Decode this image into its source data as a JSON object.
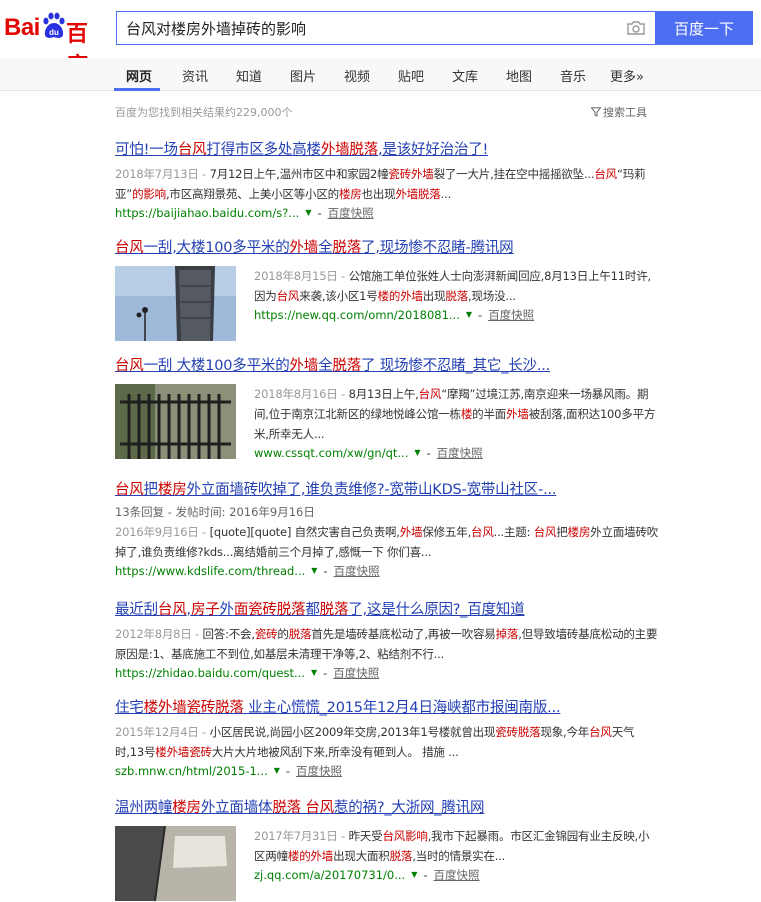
{
  "logo": {
    "left_text": "Bai",
    "right_text": "百度",
    "paw_text": "du"
  },
  "search": {
    "query": "台风对楼房外墙掉砖的影响",
    "button_label": "百度一下"
  },
  "tabs": [
    "网页",
    "资讯",
    "知道",
    "图片",
    "视频",
    "贴吧",
    "文库",
    "地图",
    "音乐",
    "更多»"
  ],
  "meta": {
    "result_count": "百度为您找到相关结果约229,000个",
    "search_tools": "搜索工具"
  },
  "snapshot_label": "百度快照",
  "results": [
    {
      "title": [
        [
          "可怕!一场",
          ""
        ],
        [
          "台风",
          "em"
        ],
        [
          "打得市区多处高楼",
          ""
        ],
        [
          "外墙脱落",
          "em"
        ],
        [
          ",是该好好治治了!",
          ""
        ]
      ],
      "abstract": [
        [
          "2018年7月13日 - ",
          "date"
        ],
        [
          "7月12日上午,温州市区中和家园2幢",
          ""
        ],
        [
          "瓷砖外墙",
          "em"
        ],
        [
          "裂了一大片,挂在空中摇摇欲坠...",
          ""
        ],
        [
          "台风",
          "em"
        ],
        [
          "“玛莉亚”",
          ""
        ],
        [
          "的影响",
          "em"
        ],
        [
          ",市区高翔景苑、上美小区等小区的",
          ""
        ],
        [
          "楼房",
          "em"
        ],
        [
          "也出现",
          ""
        ],
        [
          "外墙脱落",
          "em"
        ],
        [
          "...",
          ""
        ]
      ],
      "url": "https://baijiahao.baidu.com/s?..."
    },
    {
      "title": [
        [
          "台风",
          "em"
        ],
        [
          "一刮,大楼100多平米的",
          ""
        ],
        [
          "外墙",
          "em"
        ],
        [
          "全",
          ""
        ],
        [
          "脱落",
          "em"
        ],
        [
          "了,现场惨不忍睹-腾讯网",
          ""
        ]
      ],
      "abstract": [
        [
          "2018年8月15日 - ",
          "date"
        ],
        [
          "公馆施工单位张姓人士向澎湃新闻回应,8月13日上午11时许,因为",
          ""
        ],
        [
          "台风",
          "em"
        ],
        [
          "来袭,该小区1号",
          ""
        ],
        [
          "楼的外墙",
          "em"
        ],
        [
          "出现",
          ""
        ],
        [
          "脱落",
          "em"
        ],
        [
          ",现场没...",
          ""
        ]
      ],
      "url": "https://new.qq.com/omn/2018081..."
    },
    {
      "title": [
        [
          "台风",
          "em"
        ],
        [
          "一刮 大楼100多平米的",
          ""
        ],
        [
          "外墙",
          "em"
        ],
        [
          "全",
          ""
        ],
        [
          "脱落",
          "em"
        ],
        [
          "了 现场惨不忍睹_其它_长沙...",
          ""
        ]
      ],
      "abstract": [
        [
          "2018年8月16日 - ",
          "date"
        ],
        [
          "8月13日上午,",
          ""
        ],
        [
          "台风",
          "em"
        ],
        [
          "“摩羯”过境江苏,南京迎来一场暴风雨。期间,位于南京江北新区的绿地悦峰公馆一栋",
          ""
        ],
        [
          "楼",
          "em"
        ],
        [
          "的半面",
          ""
        ],
        [
          "外墙",
          "em"
        ],
        [
          "被刮落,面积达100多平方米,所幸无人...",
          ""
        ]
      ],
      "url": "www.cssqt.com/xw/gn/qt..."
    },
    {
      "title": [
        [
          "台风",
          "em"
        ],
        [
          "把",
          ""
        ],
        [
          "楼房",
          "em"
        ],
        [
          "外立面墙砖吹掉了,谁负责维修?-宽带山KDS-宽带山社区-...",
          ""
        ]
      ],
      "sub": "13条回复 - 发帖时间: 2016年9月16日",
      "abstract": [
        [
          "2016年9月16日 - ",
          "date"
        ],
        [
          "[quote][quote] 自然灾害自己负责啊,",
          ""
        ],
        [
          "外墙",
          "em"
        ],
        [
          "保修五年,",
          ""
        ],
        [
          "台风",
          "em"
        ],
        [
          "...主题: ",
          ""
        ],
        [
          "台风",
          "em"
        ],
        [
          "把",
          ""
        ],
        [
          "楼房",
          "em"
        ],
        [
          "外立面墙砖吹掉了,谁负责维修?kds...离结婚前三个月掉了,感慨一下 你们喜...",
          ""
        ]
      ],
      "url": "https://www.kdslife.com/thread..."
    },
    {
      "title": [
        [
          "最近刮",
          ""
        ],
        [
          "台风",
          "em"
        ],
        [
          ",",
          ""
        ],
        [
          "房子",
          "em"
        ],
        [
          "外",
          ""
        ],
        [
          "面瓷砖脱落",
          "em"
        ],
        [
          "都",
          ""
        ],
        [
          "脱落",
          "em"
        ],
        [
          "了,这是什么原因?_百度知道",
          ""
        ]
      ],
      "abstract": [
        [
          "2012年8月8日 - ",
          "date"
        ],
        [
          "回答:不会,",
          ""
        ],
        [
          "瓷砖",
          "em"
        ],
        [
          "的",
          ""
        ],
        [
          "脱落",
          "em"
        ],
        [
          "首先是墙砖基底松动了,再被一吹容易",
          ""
        ],
        [
          "掉落",
          "em"
        ],
        [
          ",但导致墙砖基底松动的主要原因是:1、基底施工不到位,如基层未清理干净等,2、粘结剂不行...",
          ""
        ]
      ],
      "url": "https://zhidao.baidu.com/quest..."
    },
    {
      "title": [
        [
          "住宅",
          ""
        ],
        [
          "楼外墙瓷砖脱落",
          "em"
        ],
        [
          " 业主心慌慌_2015年12月4日海峡都市报闽南版...",
          ""
        ]
      ],
      "abstract": [
        [
          "2015年12月4日 - ",
          "date"
        ],
        [
          "小区居民说,尚园小区2009年交房,2013年1号楼就曾出现",
          ""
        ],
        [
          "瓷砖脱落",
          "em"
        ],
        [
          "现象,今年",
          ""
        ],
        [
          "台风",
          "em"
        ],
        [
          "天气时,13号",
          ""
        ],
        [
          "楼外墙瓷砖",
          "em"
        ],
        [
          "大片大片地被风刮下来,所幸没有砸到人。 措施 ...",
          ""
        ]
      ],
      "url": "szb.mnw.cn/html/2015-1..."
    },
    {
      "title": [
        [
          "温州两幢",
          ""
        ],
        [
          "楼房",
          "em"
        ],
        [
          "外立面墙体",
          ""
        ],
        [
          "脱落",
          "em"
        ],
        [
          " ",
          ""
        ],
        [
          "台风",
          "em"
        ],
        [
          "惹的祸?_大浙网_腾讯网",
          ""
        ]
      ],
      "abstract": [
        [
          "2017年7月31日 - ",
          "date"
        ],
        [
          "昨天受",
          ""
        ],
        [
          "台风影响",
          "em"
        ],
        [
          ",我市下起暴雨。市区汇金锦园有业主反映,小区两幢",
          ""
        ],
        [
          "楼的外墙",
          "em"
        ],
        [
          "出现大面积",
          ""
        ],
        [
          "脱落",
          "em"
        ],
        [
          ",当时的情景实在...",
          ""
        ]
      ],
      "url": "zj.qq.com/a/20170731/0..."
    }
  ]
}
